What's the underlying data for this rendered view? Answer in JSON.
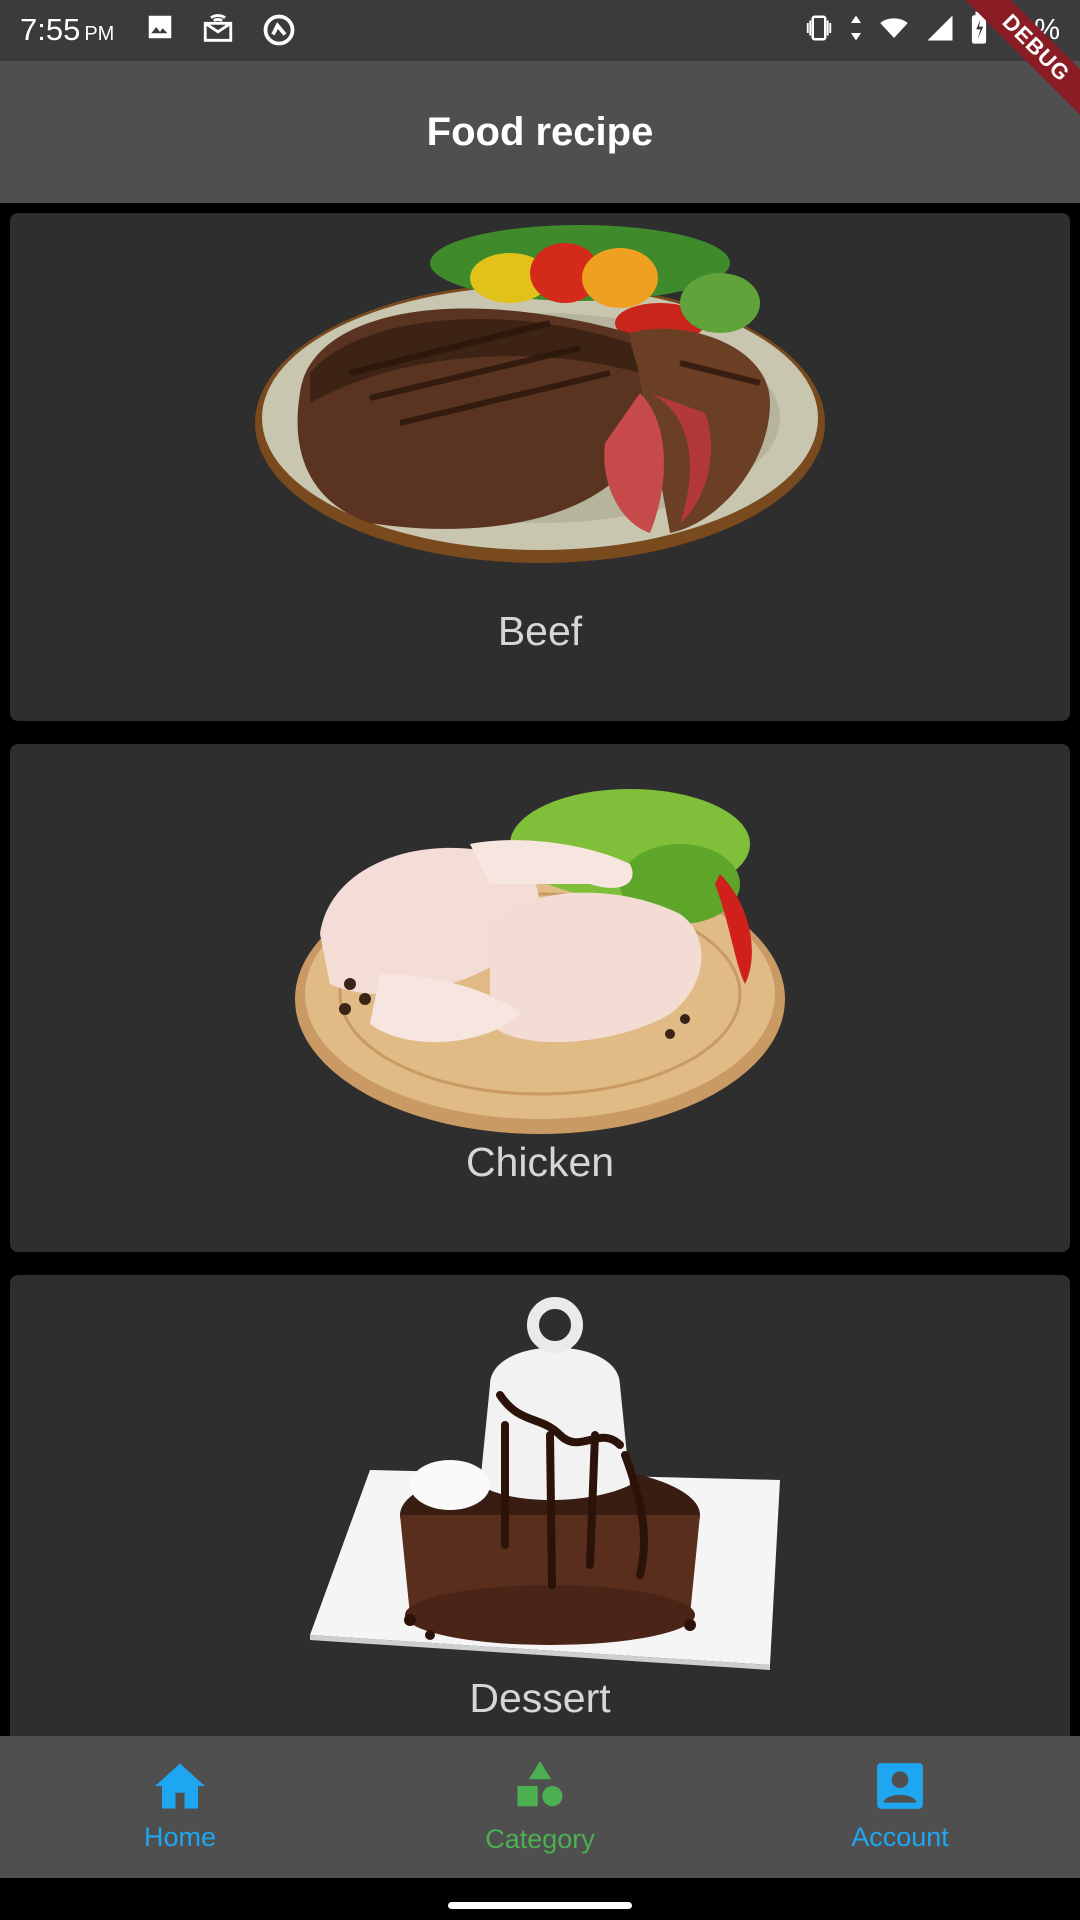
{
  "status_bar": {
    "time": "7:55",
    "ampm": "PM",
    "battery": "98%"
  },
  "debug_banner": "DEBUG",
  "app_bar": {
    "title": "Food recipe"
  },
  "categories": [
    {
      "label": "Beef",
      "icon": "beef-steak-image"
    },
    {
      "label": "Chicken",
      "icon": "chicken-legs-image"
    },
    {
      "label": "Dessert",
      "icon": "dessert-cake-image"
    }
  ],
  "bottom_nav": {
    "items": [
      {
        "label": "Home",
        "icon": "home-icon",
        "color": "#1ea7f0"
      },
      {
        "label": "Category",
        "icon": "category-shapes-icon",
        "color": "#4caf50"
      },
      {
        "label": "Account",
        "icon": "account-box-icon",
        "color": "#1ea7f0"
      }
    ]
  },
  "colors": {
    "status_bar_bg": "#3b3b3b",
    "app_bar_bg": "#4f4f4f",
    "card_bg": "#2e2e2e",
    "accent_blue": "#1ea7f0",
    "accent_green": "#4caf50"
  }
}
